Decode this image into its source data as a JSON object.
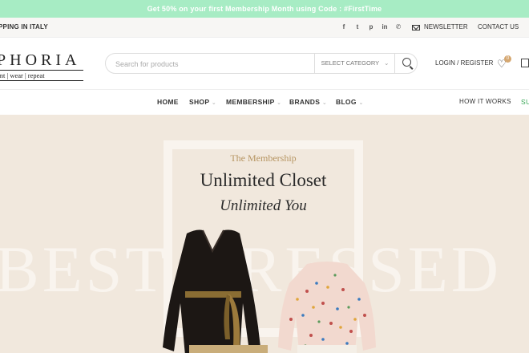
{
  "promo": {
    "text": "Get 50% on your first Membership Month using Code : #FirstTime"
  },
  "topbar": {
    "shipping": "PPING IN ITALY",
    "social_icons": [
      "facebook-icon",
      "twitter-icon",
      "pinterest-icon",
      "linkedin-icon",
      "whatsapp-icon"
    ],
    "newsletter": "NEWSLETTER",
    "contact": "CONTACT US"
  },
  "header": {
    "logo_name": "PHORIA",
    "logo_tagline": "ent | wear | repeat",
    "search_placeholder": "Search for products",
    "category_label": "SELECT CATEGORY",
    "login_label": "LOGIN / REGISTER",
    "wishlist_count": "0"
  },
  "nav": {
    "items": [
      {
        "label": "HOME"
      },
      {
        "label": "SHOP"
      },
      {
        "label": "MEMBERSHIP"
      },
      {
        "label": "BRANDS"
      },
      {
        "label": "BLOG"
      }
    ],
    "how_it_works": "HOW IT WORKS",
    "right_partial": "SU"
  },
  "hero": {
    "eyebrow": "The Membership",
    "title": "Unlimited Closet",
    "subtitle": "Unlimited You",
    "background_text": "BEST DRESSED"
  },
  "colors": {
    "promo_bg": "#a7ecc4",
    "hero_bg": "#f1e8dd",
    "accent_gold": "#b69562",
    "badge": "#d5a770",
    "nav_right_green": "#3aa757"
  }
}
